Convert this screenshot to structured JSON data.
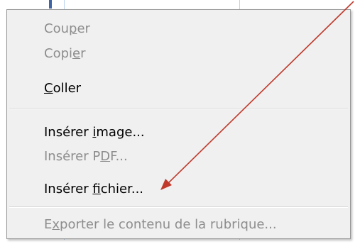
{
  "menu": {
    "items": [
      {
        "pre": "Cou",
        "mn": "p",
        "post": "er",
        "enabled": false
      },
      {
        "pre": "Copi",
        "mn": "e",
        "post": "r",
        "enabled": false
      },
      {
        "pre": "",
        "mn": "C",
        "post": "oller",
        "enabled": true
      },
      {
        "pre": "Insérer ",
        "mn": "i",
        "post": "mage...",
        "enabled": true
      },
      {
        "pre": "Insérer P",
        "mn": "D",
        "post": "F...",
        "enabled": false
      },
      {
        "pre": "Insérer ",
        "mn": "f",
        "post": "ichier...",
        "enabled": true
      },
      {
        "pre": "E",
        "mn": "x",
        "post": "porter le contenu de la rubrique...",
        "enabled": false
      }
    ]
  },
  "annotation": {
    "arrow_color": "#c0392b"
  }
}
